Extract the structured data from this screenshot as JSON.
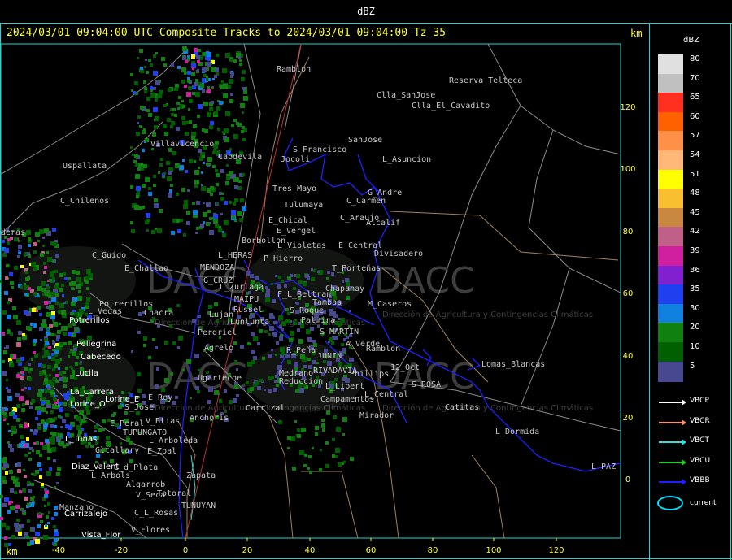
{
  "header": {
    "title": "dBZ",
    "subtitle": "2024/03/01 09:04:00 UTC Composite Tracks to 2024/03/01 09:04:00 Tz 35",
    "km_top": "km",
    "km_bottom": "km"
  },
  "watermark": "DACC",
  "watermark_sub": "Dirección de Agricultura y Contingencias Climáticas",
  "axes": {
    "x_ticks": [
      "-40",
      "-20",
      "0",
      "20",
      "40",
      "60",
      "80",
      "100",
      "120"
    ],
    "y_ticks": [
      "120",
      "100",
      "80",
      "60",
      "40",
      "20",
      "0"
    ]
  },
  "legend": {
    "unit": "dBZ",
    "scale": [
      {
        "value": "80",
        "color": "#e0e0e0"
      },
      {
        "value": "70",
        "color": "#c0c0c0"
      },
      {
        "value": "65",
        "color": "#ff3020"
      },
      {
        "value": "60",
        "color": "#ff6000"
      },
      {
        "value": "57",
        "color": "#ff9048"
      },
      {
        "value": "54",
        "color": "#ffb878"
      },
      {
        "value": "51",
        "color": "#ffff00"
      },
      {
        "value": "48",
        "color": "#f8c030"
      },
      {
        "value": "45",
        "color": "#c88840"
      },
      {
        "value": "42",
        "color": "#c06088"
      },
      {
        "value": "39",
        "color": "#d020a0"
      },
      {
        "value": "36",
        "color": "#8020d0"
      },
      {
        "value": "35",
        "color": "#2040f0"
      },
      {
        "value": "30",
        "color": "#1080e0"
      },
      {
        "value": "20",
        "color": "#108010"
      },
      {
        "value": "10",
        "color": "#006000"
      },
      {
        "value": "5",
        "color": "#484890"
      }
    ],
    "tracks": [
      {
        "label": "VBCP",
        "color": "#ffffff"
      },
      {
        "label": "VBCR",
        "color": "#ff9070"
      },
      {
        "label": "VBCT",
        "color": "#30e0e0"
      },
      {
        "label": "VBCU",
        "color": "#20d020"
      },
      {
        "label": "VBBB",
        "color": "#2020ff"
      }
    ],
    "current_label": "current"
  },
  "places_gray": [
    "Ramblon",
    "Reserva_Telteca",
    "Clla_SanJose",
    "Clla_El_Cavadito",
    "SanJose",
    "S_Francisco",
    "Jocoli",
    "L_Asuncion",
    "Villavicencio",
    "Capdevila",
    "Uspallata",
    "Tres_Mayo",
    "G_Andre",
    "C_Carmen",
    "Tulumaya",
    "C_Chilenos",
    "E_Chical",
    "C_Araujo",
    "Alcalif",
    "E_Vergel",
    "deras",
    "Borbollon",
    "L_Violetas",
    "E_Central",
    "Divisadero",
    "C_Guido",
    "L_HERAS",
    "P_Hierro",
    "T_Porteñas",
    "E_Challao",
    "MENDOZA",
    "G_CRUZ",
    "L_Zurlaga",
    "F_L_Beltran",
    "Chapanay",
    "MAIPU",
    "Tambas",
    "M_Caseros",
    "Potrerillos",
    "L_Vegas",
    "Chacra",
    "Lujan",
    "Russel",
    "S_Roque",
    "Palmira",
    "Lunlunta",
    "Perdriel",
    "S_MARTIN",
    "A_Verde",
    "Agrelo",
    "R_Peña",
    "JUNIN",
    "Ramblon",
    "Lomas_Blancas",
    "Ugarteche",
    "Medrano",
    "RIVADAVIA",
    "Phillips",
    "12_Oct",
    "S_ROSA",
    "Reduccion",
    "L_Libert",
    "Campamentos",
    "L_Central",
    "E_Rey",
    "S_Jose",
    "Carrizal",
    "Catitas",
    "Anchoris",
    "Mirador",
    "E_Peral",
    "V_Btias",
    "L_Dormida",
    "TUPUNGATO",
    "L_Arboleda",
    "Gltallary",
    "E_Zpal",
    "L_PAZ",
    "C_d_Plata",
    "L_Arbols",
    "Zapata",
    "Algarrob",
    "V_Seca",
    "Totoral",
    "TUNUYAN",
    "Manzano",
    "C_L_Rosas",
    "V_Flores"
  ],
  "places_white": [
    "Potrerillos",
    "Pellegrina",
    "Cabecedo",
    "Lucila",
    "La_Carrera",
    "Lorine_E",
    "Lorine_O",
    "L_Tunas",
    "Diaz_Valent",
    "Carrizalejo",
    "Vista_Flor"
  ]
}
